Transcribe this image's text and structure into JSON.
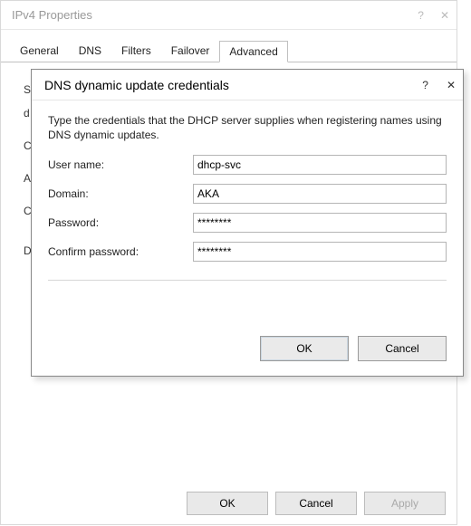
{
  "parent": {
    "title": "IPv4 Properties",
    "help_glyph": "?",
    "close_glyph": "✕",
    "tabs": [
      "General",
      "DNS",
      "Filters",
      "Failover",
      "Advanced"
    ],
    "active_tab_index": 4,
    "bg_letters": [
      "S",
      "d",
      "C",
      "A",
      "C",
      "D"
    ],
    "buttons": {
      "ok": "OK",
      "cancel": "Cancel",
      "apply": "Apply"
    }
  },
  "dialog": {
    "title": "DNS dynamic update credentials",
    "help_glyph": "?",
    "close_glyph": "✕",
    "description": "Type the credentials that the DHCP server supplies when registering names using DNS dynamic updates.",
    "fields": {
      "username_label": "User name:",
      "username_value": "dhcp-svc",
      "domain_label": "Domain:",
      "domain_value": "AKA",
      "password_label": "Password:",
      "password_value": "********",
      "confirm_label": "Confirm password:",
      "confirm_value": "********"
    },
    "buttons": {
      "ok": "OK",
      "cancel": "Cancel"
    }
  }
}
